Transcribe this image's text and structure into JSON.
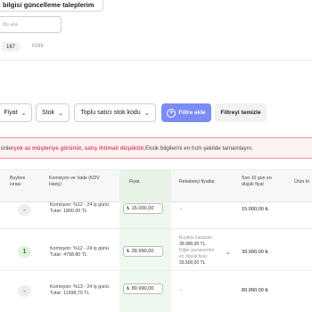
{
  "top_button_label": "bilgisi güncelleme taleplerim",
  "search": {
    "placeholder": "du ara"
  },
  "counter": {
    "value": "167",
    "label": "Kilitli"
  },
  "filters": {
    "fiyat": "Fiyat",
    "stok": "Stok",
    "toplu": "Toplu satıcı stok kodu",
    "add": "Filtre ekle",
    "clear": "Filtreyi temizle"
  },
  "alert": {
    "pre": "ünler ",
    "bold": "çok az müşteriye görünür, satış ihtimali düşüktür.",
    "post": " Eksik bilgilerini en hızlı şekilde tamamlayın."
  },
  "table": {
    "headers": {
      "buybox": "Buybox sırası",
      "komisyon": "Komisyon ve Vade (KDV Hariç)",
      "fiyat": "Fiyat",
      "rekabet": "Rekabetçi fiyatlar",
      "son10": "Son 10 gün en düşük fiyat",
      "urun": "Ürün bi"
    },
    "rows": [
      {
        "buybox": "-",
        "komisyon1": "Komisyon: %12 - 24 iş günü",
        "komisyon2": "Tutar: 1800.00 TL",
        "fiyat": "15.000,00",
        "rekabet": "-",
        "son10": "15.000,00 ₺"
      },
      {
        "buybox": "1",
        "komisyon1": "Komisyon: %12 - 24 iş günü",
        "komisyon2": "Tutar: 4798.80 TL",
        "fiyat": "39.990,00",
        "rekabet_l1": "Buybox kazanan",
        "rekabet_l2": "39.990,00 TL",
        "rekabet_l3": "Diğer pazaryerleri",
        "rekabet_l4": "en düşük fiyat",
        "rekabet_l5": "33.500,00 TL",
        "son10": "39.990,00 ₺"
      },
      {
        "buybox": "-",
        "komisyon1": "Komisyon: %13 - 24 iş günü",
        "komisyon2": "Tutar: 11698,70 TL",
        "fiyat": "89.990,00",
        "rekabet": "-",
        "son10": "89.990,00 ₺"
      }
    ],
    "currency_symbol": "₺"
  }
}
